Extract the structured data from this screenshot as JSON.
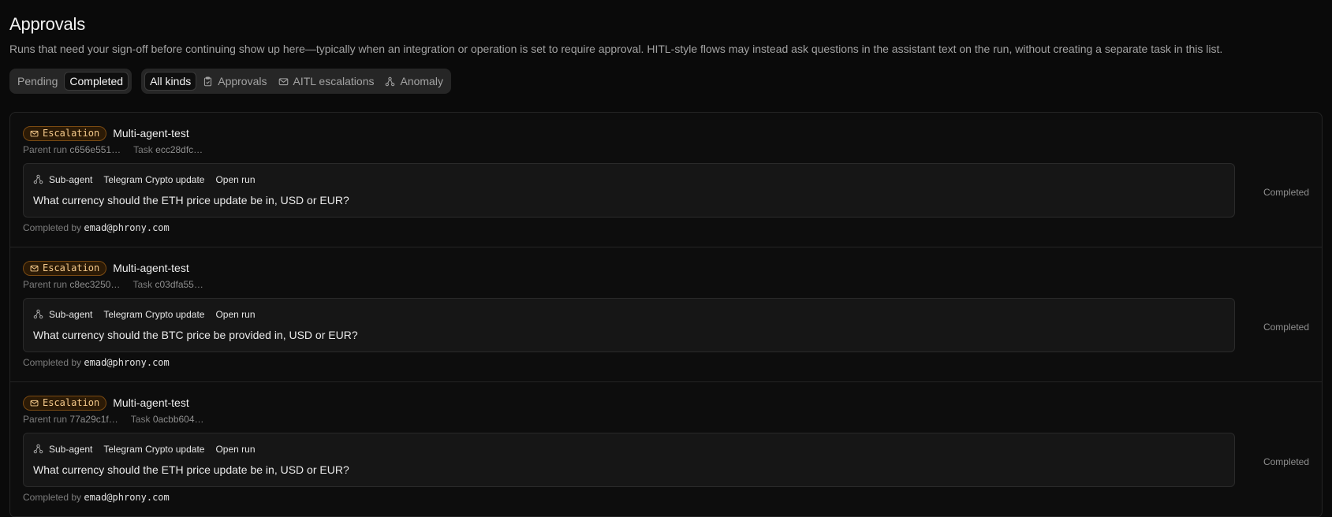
{
  "page": {
    "title": "Approvals",
    "description": "Runs that need your sign-off before continuing show up here—typically when an integration or operation is set to require approval. HITL-style flows may instead ask questions in the assistant text on the run, without creating a separate task in this list."
  },
  "filters": {
    "status": {
      "pending": "Pending",
      "completed": "Completed",
      "active": "completed"
    },
    "kinds": {
      "all": "All kinds",
      "approvals": "Approvals",
      "aitl": "AITL escalations",
      "anomaly": "Anomaly",
      "active": "all"
    }
  },
  "colors": {
    "accent_badge_border": "#7a4a12",
    "accent_badge_text": "#f4c98a",
    "background": "#0a0a0a"
  },
  "items": [
    {
      "badge": "Escalation",
      "workflow": "Multi-agent-test",
      "parent_run_label": "Parent run",
      "parent_run": "c656e551…",
      "task_label": "Task",
      "task": "ecc28dfc…",
      "sub_agent_label": "Sub-agent",
      "sub_agent_name": "Telegram Crypto update",
      "open_run": "Open run",
      "question": "What currency should the ETH price update be in, USD or EUR?",
      "completed_by_label": "Completed by",
      "completed_by": "emad@phrony.com",
      "status": "Completed"
    },
    {
      "badge": "Escalation",
      "workflow": "Multi-agent-test",
      "parent_run_label": "Parent run",
      "parent_run": "c8ec3250…",
      "task_label": "Task",
      "task": "c03dfa55…",
      "sub_agent_label": "Sub-agent",
      "sub_agent_name": "Telegram Crypto update",
      "open_run": "Open run",
      "question": "What currency should the BTC price be provided in, USD or EUR?",
      "completed_by_label": "Completed by",
      "completed_by": "emad@phrony.com",
      "status": "Completed"
    },
    {
      "badge": "Escalation",
      "workflow": "Multi-agent-test",
      "parent_run_label": "Parent run",
      "parent_run": "77a29c1f…",
      "task_label": "Task",
      "task": "0acbb604…",
      "sub_agent_label": "Sub-agent",
      "sub_agent_name": "Telegram Crypto update",
      "open_run": "Open run",
      "question": "What currency should the ETH price update be in, USD or EUR?",
      "completed_by_label": "Completed by",
      "completed_by": "emad@phrony.com",
      "status": "Completed"
    }
  ]
}
